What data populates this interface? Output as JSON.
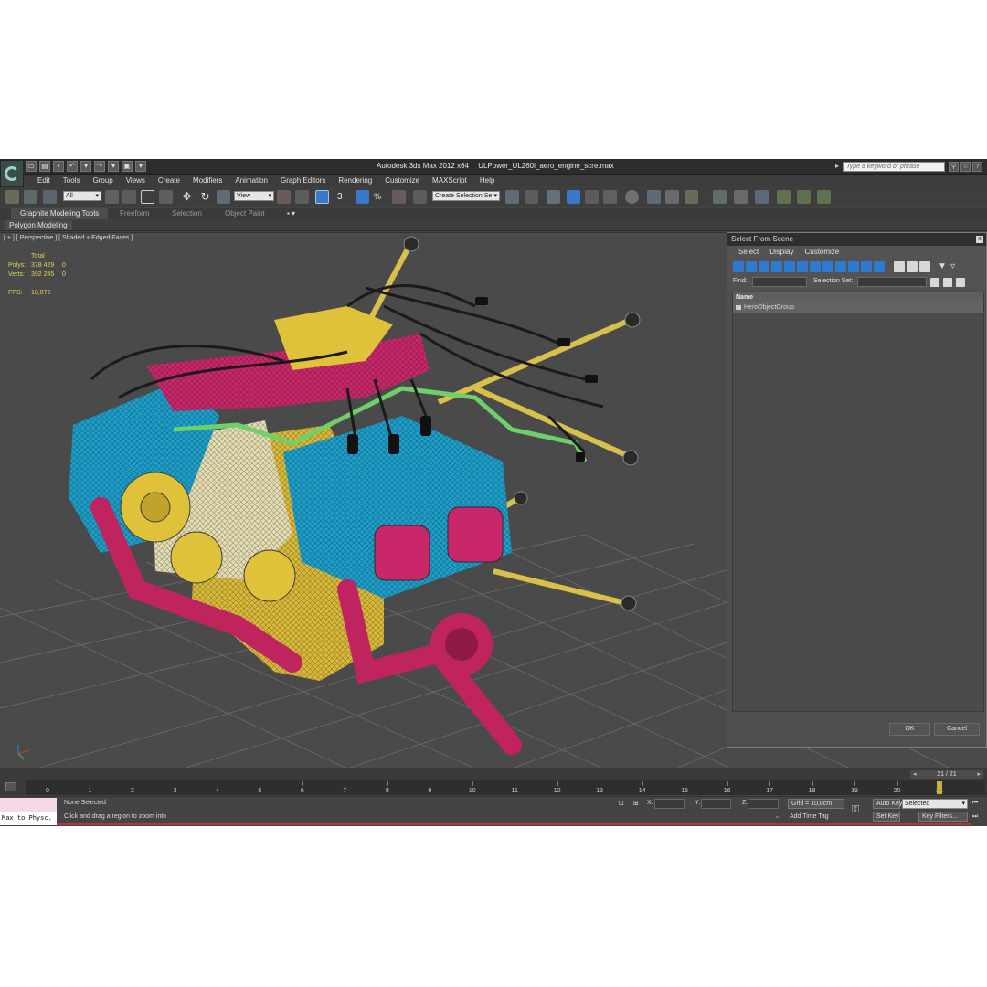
{
  "window": {
    "title_app": "Autodesk 3ds Max  2012 x64",
    "title_file": "ULPower_UL260i_aero_engine_scre.max",
    "search_placeholder": "Type a keyword or phrase"
  },
  "menu": [
    "Edit",
    "Tools",
    "Group",
    "Views",
    "Create",
    "Modifiers",
    "Animation",
    "Graph Editors",
    "Rendering",
    "Customize",
    "MAXScript",
    "Help"
  ],
  "toolbar": {
    "filter_value": "All",
    "coord_value": "View",
    "selection_set_placeholder": "Create Selection Se",
    "snap_label": "3",
    "percent_label": "%"
  },
  "ribbon": {
    "tabs": [
      "Graphite Modeling Tools",
      "Freeform",
      "Selection",
      "Object Paint"
    ],
    "panel": "Polygon Modeling"
  },
  "viewport": {
    "label": "[ + ] [ Perspective ] [ Shaded + Edged Faces ]",
    "stats": {
      "header": "Total",
      "polys_label": "Polys:",
      "polys_total": "378 429",
      "polys_sel": "0",
      "verts_label": "Verts:",
      "verts_total": "392 245",
      "verts_sel": "0",
      "fps_label": "FPS:",
      "fps_value": "18,872"
    },
    "colors": {
      "cyan": "#1e9ec8",
      "yellow": "#e0c13a",
      "magenta": "#c8286a",
      "pink": "#d03a78",
      "green": "#6fd06a",
      "cream": "#e2dcb0",
      "grid": "#7a7a7a"
    }
  },
  "dialog": {
    "title": "Select From Scene",
    "close": "x",
    "menu": [
      "Select",
      "Display",
      "Customize"
    ],
    "find_label": "Find:",
    "selection_set_label": "Selection Set:",
    "column_header": "Name",
    "items": [
      "HeroObjectGroup"
    ],
    "ok": "OK",
    "cancel": "Cancel"
  },
  "timeline": {
    "frame_counter": "21 / 21",
    "ticks": [
      "0",
      "1",
      "2",
      "3",
      "4",
      "5",
      "6",
      "7",
      "8",
      "9",
      "10",
      "11",
      "12",
      "13",
      "14",
      "15",
      "16",
      "17",
      "18",
      "19",
      "20",
      "21"
    ]
  },
  "status": {
    "maxscript_label": "Max to Physc.",
    "selection": "None Selected",
    "prompt": "Click and drag a region to zoom into",
    "x_label": "X:",
    "y_label": "Y:",
    "z_label": "Z:",
    "grid": "Grid = 10,0cm",
    "add_time_tag": "Add Time Tag",
    "auto_key": "Auto Key",
    "set_key": "Set Key",
    "key_mode": "Selected",
    "key_filters": "Key Filters..."
  }
}
